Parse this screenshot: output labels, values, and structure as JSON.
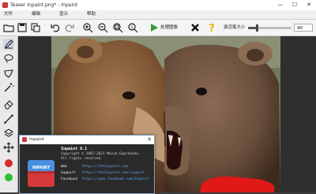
{
  "window": {
    "title": "Teaser Inpaint.png* - Inpaint"
  },
  "menu": {
    "items": [
      "文件",
      "编辑",
      "显示",
      "帮助"
    ]
  },
  "toolbar": {
    "run_label": "处理图像",
    "radius_label": "激活笔大小",
    "radius_value": "40",
    "radius_fraction": 0.2,
    "buttons": [
      "open-folder",
      "save",
      "copy",
      "undo",
      "redo",
      "zoom-in",
      "zoom-out",
      "zoom-fit",
      "zoom-actual",
      "run",
      "cancel",
      "help"
    ]
  },
  "tools": [
    "marker",
    "lasso",
    "polygon-lasso",
    "magic-wand",
    "eraser",
    "line",
    "layers",
    "move"
  ],
  "colors": {
    "accent": "#3a9a3a",
    "red_dot": "#d92a2a",
    "green_dot": "#2fbf2f",
    "mask": "#e01818",
    "link": "#5da3ea"
  },
  "about": {
    "window_title": "Inpaint",
    "product": "Inpaint 8.1",
    "copyright": "Copyright © 2007-2021 Maxim Gapchenko.",
    "all_rights": "All rights reserved.",
    "rows": [
      {
        "key": "Web",
        "value": "https://theInpaint.com"
      },
      {
        "key": "Support",
        "value": "https://theInpaint.com/support"
      },
      {
        "key": "Facebook",
        "value": "https://www.facebook.com/Inpaint"
      }
    ],
    "box_text": "INPAINT"
  }
}
